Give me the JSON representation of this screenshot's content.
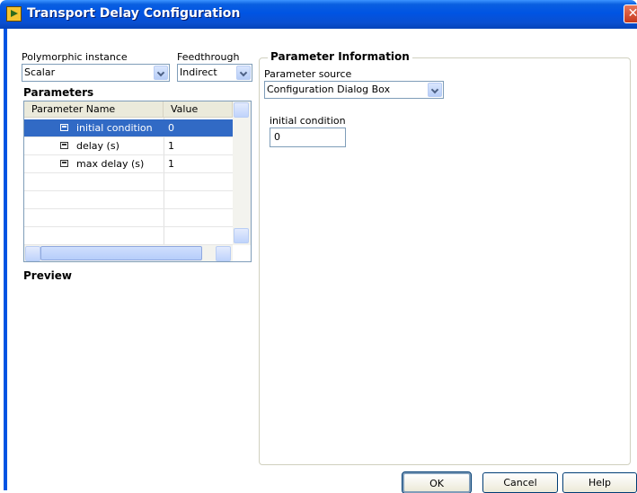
{
  "window": {
    "title": "Transport Delay Configuration"
  },
  "polymorphic": {
    "label": "Polymorphic instance",
    "value": "Scalar"
  },
  "feedthrough": {
    "label": "Feedthrough",
    "value": "Indirect"
  },
  "parameters": {
    "heading": "Parameters",
    "columns": [
      "Parameter Name",
      "Value"
    ],
    "rows": [
      {
        "name": "initial condition",
        "value": "0",
        "selected": true
      },
      {
        "name": "delay (s)",
        "value": "1",
        "selected": false
      },
      {
        "name": "max delay (s)",
        "value": "1",
        "selected": false
      }
    ]
  },
  "preview": {
    "heading": "Preview"
  },
  "param_info": {
    "heading": "Parameter Information",
    "source_label": "Parameter source",
    "source_value": "Configuration Dialog Box",
    "field_label": "initial condition",
    "field_value": "0"
  },
  "buttons": {
    "ok": "OK",
    "cancel": "Cancel",
    "help": "Help"
  },
  "colors": {
    "selection": "#316ac5",
    "titlebar": "#0054e3"
  }
}
